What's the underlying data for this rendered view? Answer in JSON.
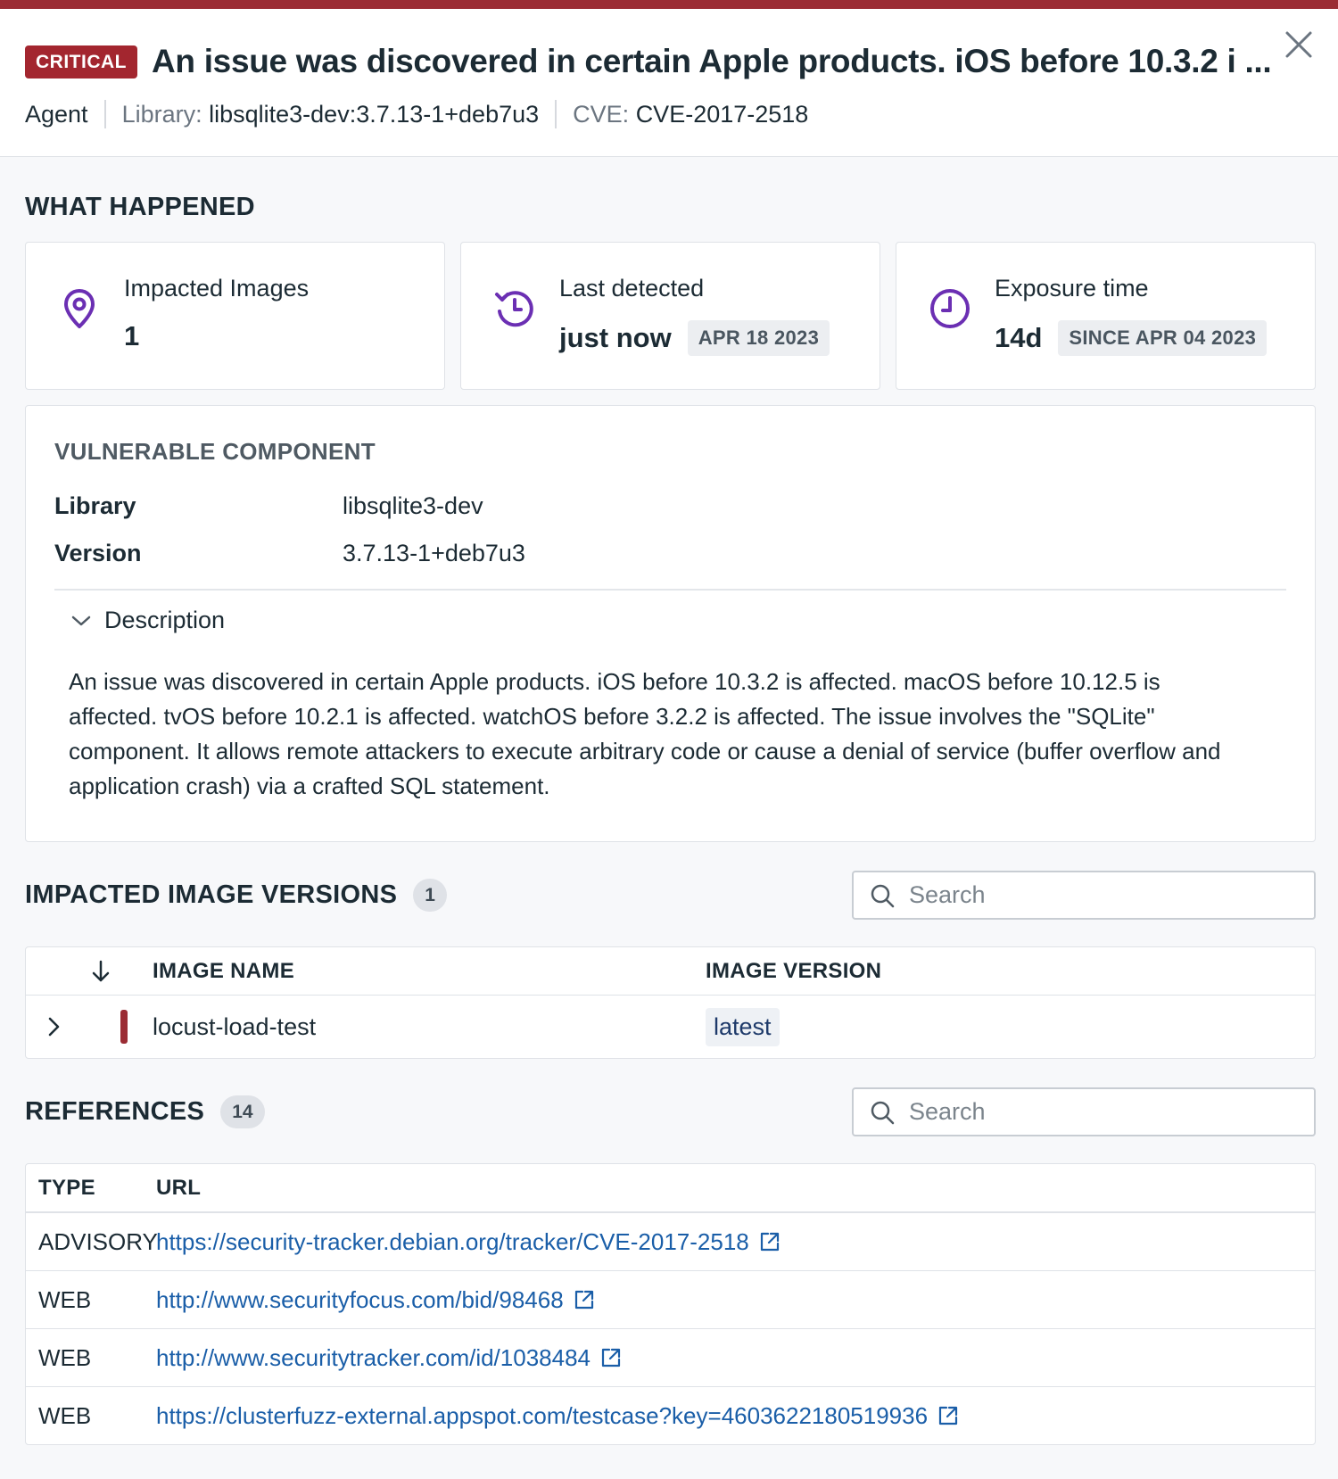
{
  "header": {
    "severity": "CRITICAL",
    "title": "An issue was discovered in certain Apple products. iOS before 10.3.2 i ...",
    "source": "Agent",
    "library_key": "Library:",
    "library_value": "libsqlite3-dev:3.7.13-1+deb7u3",
    "cve_key": "CVE:",
    "cve_value": "CVE-2017-2518"
  },
  "what_happened": {
    "title": "WHAT HAPPENED",
    "impacted": {
      "label": "Impacted Images",
      "value": "1",
      "icon": "location-pin-icon"
    },
    "last_detected": {
      "label": "Last detected",
      "value": "just now",
      "date": "APR 18 2023",
      "icon": "history-clock-icon"
    },
    "exposure": {
      "label": "Exposure time",
      "value": "14d",
      "since": "SINCE APR 04 2023",
      "icon": "clock-icon"
    }
  },
  "component": {
    "title": "VULNERABLE COMPONENT",
    "library_label": "Library",
    "library_value": "libsqlite3-dev",
    "version_label": "Version",
    "version_value": "3.7.13-1+deb7u3",
    "description_label": "Description",
    "description": "An issue was discovered in certain Apple products. iOS before 10.3.2 is affected. macOS before 10.12.5 is affected. tvOS before 10.2.1 is affected. watchOS before 3.2.2 is affected. The issue involves the \"SQLite\" component. It allows remote attackers to execute arbitrary code or cause a denial of service (buffer overflow and application crash) via a crafted SQL statement."
  },
  "impacted_versions": {
    "title": "IMPACTED IMAGE VERSIONS",
    "count": "1",
    "search_placeholder": "Search",
    "col_name": "IMAGE NAME",
    "col_version": "IMAGE VERSION",
    "rows": [
      {
        "name": "locust-load-test",
        "version": "latest"
      }
    ]
  },
  "references": {
    "title": "REFERENCES",
    "count": "14",
    "search_placeholder": "Search",
    "col_type": "TYPE",
    "col_url": "URL",
    "rows": [
      {
        "type": "ADVISORY",
        "url": "https://security-tracker.debian.org/tracker/CVE-2017-2518"
      },
      {
        "type": "WEB",
        "url": "http://www.securityfocus.com/bid/98468"
      },
      {
        "type": "WEB",
        "url": "http://www.securitytracker.com/id/1038484"
      },
      {
        "type": "WEB",
        "url": "https://clusterfuzz-external.appspot.com/testcase?key=4603622180519936"
      }
    ]
  },
  "colors": {
    "critical": "#a3262f",
    "accent_icon": "#6b2fb3",
    "link": "#1a5ea8"
  }
}
